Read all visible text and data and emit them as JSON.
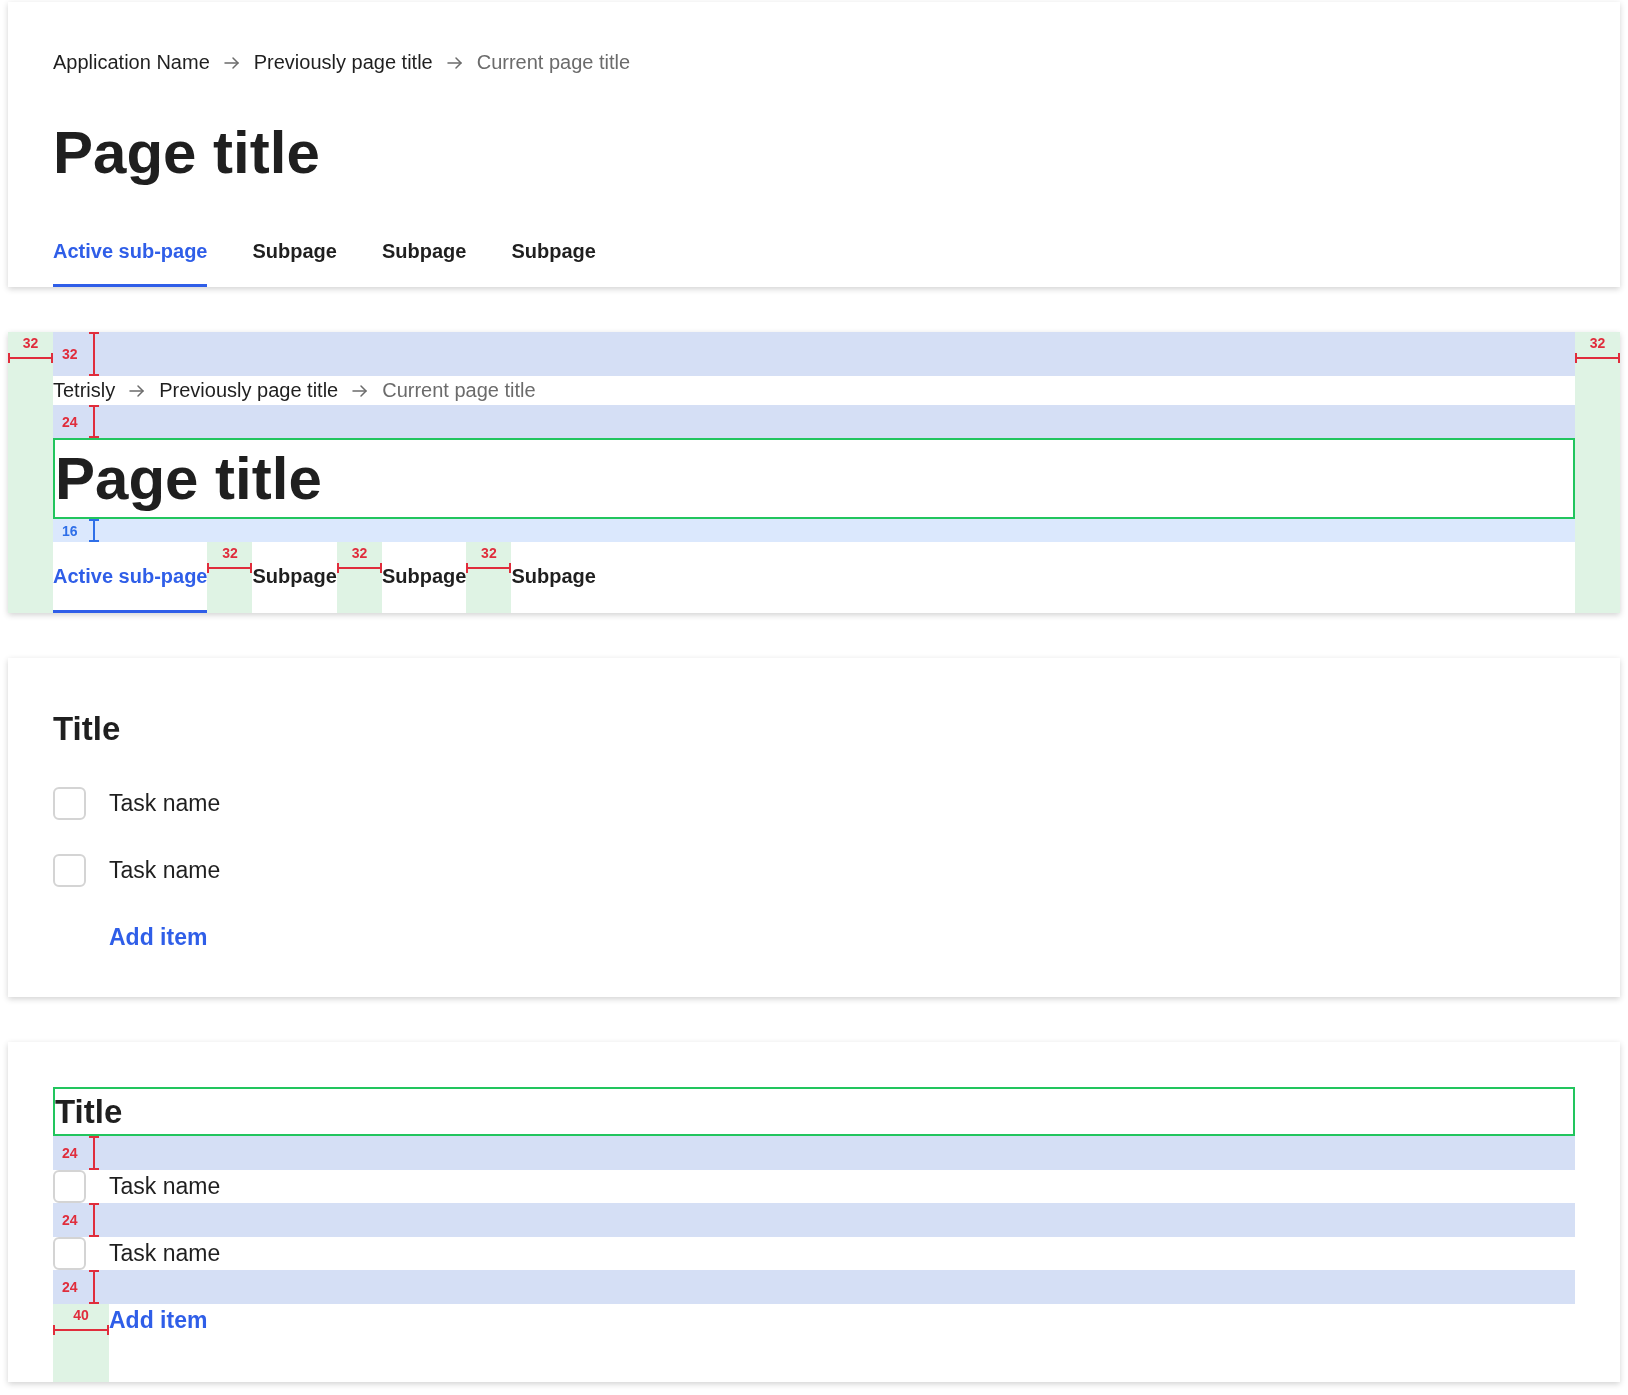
{
  "header": {
    "breadcrumb": [
      {
        "label": "Application Name",
        "current": false
      },
      {
        "label": "Previously page title",
        "current": false
      },
      {
        "label": "Current page title",
        "current": true
      }
    ],
    "title": "Page title",
    "tabs": [
      {
        "label": "Active sub-page",
        "selected": true
      },
      {
        "label": "Subpage",
        "selected": false
      },
      {
        "label": "Subpage",
        "selected": false
      },
      {
        "label": "Subpage",
        "selected": false
      }
    ]
  },
  "spec_header": {
    "left_padding_label": "32",
    "top_padding_label": "32",
    "right_padding_label": "32",
    "breadcrumb": [
      {
        "label": "Tetrisly",
        "current": false
      },
      {
        "label": "Previously page title",
        "current": false
      },
      {
        "label": "Current page title",
        "current": true
      }
    ],
    "breadcrumb_gap_label": "24",
    "title": "Page title",
    "title_gap_label": "16",
    "tabs": [
      {
        "label": "Active sub-page",
        "selected": true
      },
      {
        "label": "Subpage",
        "selected": false
      },
      {
        "label": "Subpage",
        "selected": false
      },
      {
        "label": "Subpage",
        "selected": false
      }
    ],
    "tab_gap_labels": [
      "32",
      "32",
      "32"
    ]
  },
  "task_card": {
    "title": "Title",
    "tasks": [
      {
        "name": "Task name",
        "checked": false
      },
      {
        "name": "Task name",
        "checked": false
      }
    ],
    "add_button": "Add item"
  },
  "spec_task_card": {
    "title": "Title",
    "gap_labels": [
      "24",
      "24",
      "24"
    ],
    "tasks": [
      {
        "name": "Task name",
        "checked": false
      },
      {
        "name": "Task name",
        "checked": false
      }
    ],
    "add_button": "Add item",
    "indent_label": "40"
  }
}
